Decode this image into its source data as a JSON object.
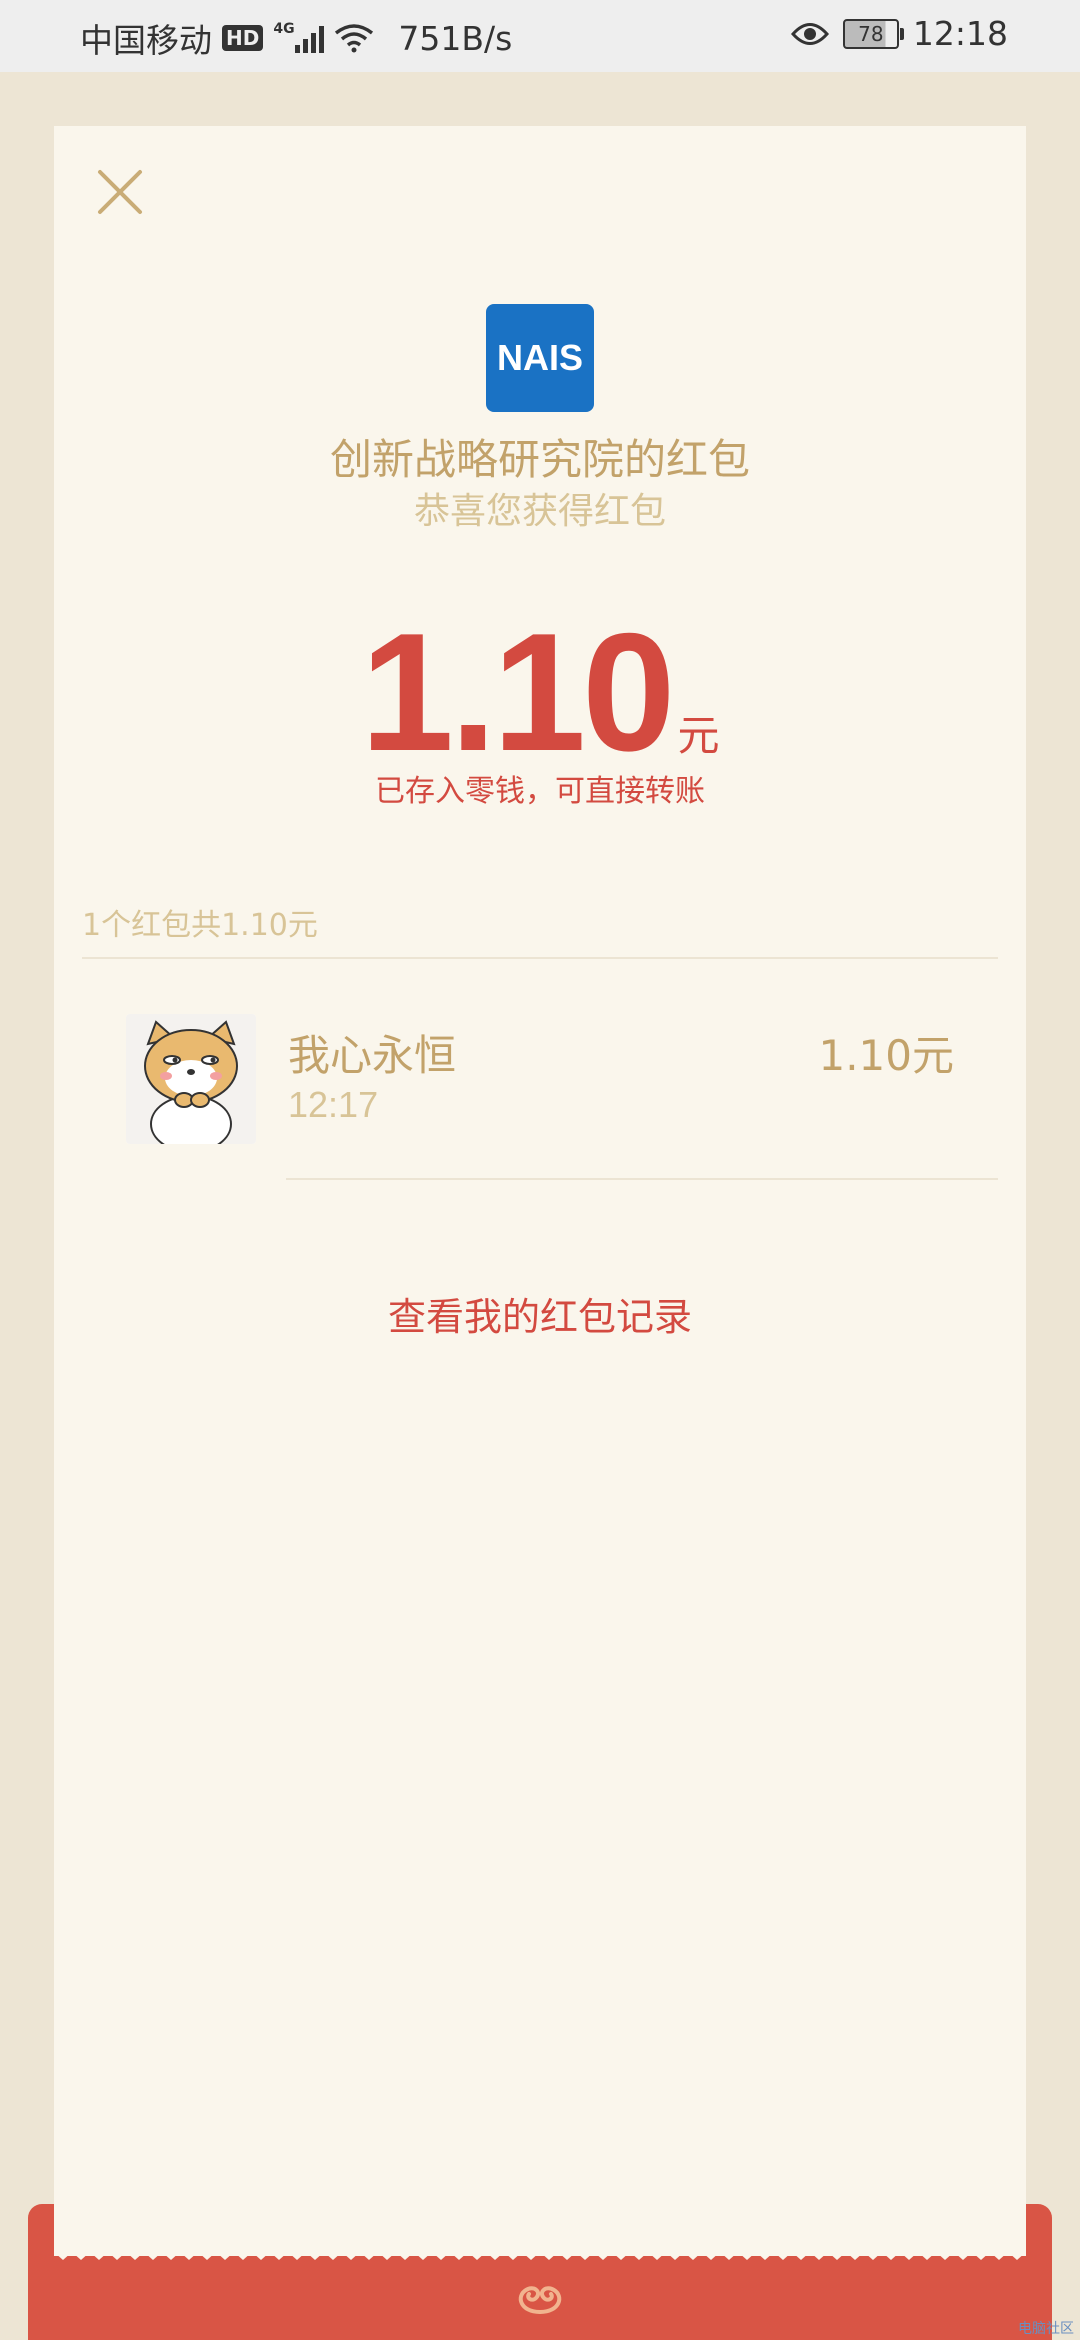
{
  "status_bar": {
    "carrier": "中国移动",
    "hd": "HD",
    "network": "4G",
    "speed": "751B/s",
    "battery": "78",
    "time": "12:18"
  },
  "red_packet": {
    "logo_text": "NAIS",
    "sender_title": "创新战略研究院的红包",
    "greeting": "恭喜您获得红包",
    "amount": "1.10",
    "unit": "元",
    "stored_note": "已存入零钱，可直接转账",
    "summary": "1个红包共1.10元"
  },
  "recipients": [
    {
      "name": "我心永恒",
      "time": "12:17",
      "amount": "1.10元"
    }
  ],
  "records_link": "查看我的红包记录",
  "watermark": "电脑社区",
  "colors": {
    "accent_red": "#d34a40",
    "gold_text": "#c2a26a",
    "light_gold": "#d8c497",
    "logo_blue": "#1a72c4",
    "card_bg": "#faf6ec",
    "page_bg": "#ede5d4"
  }
}
